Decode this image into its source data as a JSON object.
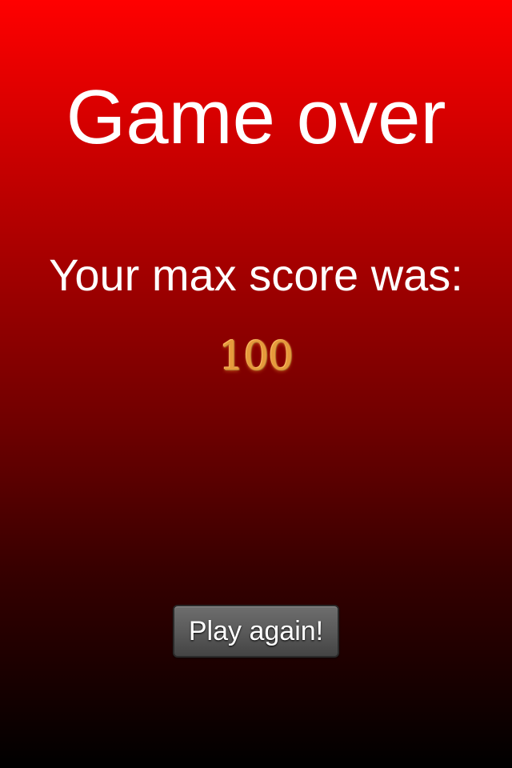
{
  "screen": {
    "title": "Game over",
    "subtitle": "Your max score was:",
    "score": "100",
    "play_again_label": "Play again!"
  },
  "colors": {
    "background_top": "#ff0000",
    "background_bottom": "#000000",
    "text": "#ffffff",
    "score": "#e69a3c",
    "button": "#5a5a5a"
  }
}
